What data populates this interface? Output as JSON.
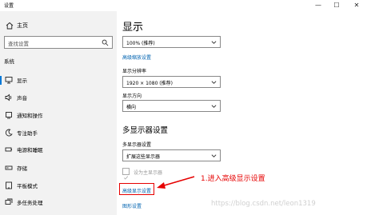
{
  "window": {
    "title": "设置",
    "controls": {
      "minimize": "—",
      "maximize": "☐",
      "close": "✕"
    }
  },
  "sidebar": {
    "home_label": "主页",
    "search_placeholder": "查找设置",
    "section_label": "系统",
    "items": [
      {
        "label": "显示",
        "icon": "monitor-icon",
        "selected": true
      },
      {
        "label": "声音",
        "icon": "speaker-icon"
      },
      {
        "label": "通知和操作",
        "icon": "notification-icon"
      },
      {
        "label": "专注助手",
        "icon": "moon-icon"
      },
      {
        "label": "电源和睡眠",
        "icon": "power-icon"
      },
      {
        "label": "存储",
        "icon": "storage-icon"
      },
      {
        "label": "平板模式",
        "icon": "tablet-icon"
      },
      {
        "label": "多任务处理",
        "icon": "multitask-icon"
      }
    ]
  },
  "main": {
    "title": "显示",
    "scale_value": "100% (推荐)",
    "advanced_scaling_link": "高级缩放设置",
    "resolution_label": "显示分辨率",
    "resolution_value": "1920 × 1080 (推荐)",
    "orientation_label": "显示方向",
    "orientation_value": "横向",
    "multi_display_heading": "多显示器设置",
    "multi_display_label": "多显示器设置",
    "multi_display_value": "扩展这些显示器",
    "main_display_checkbox": "设为主显示器",
    "advanced_display_link": "高级显示设置",
    "graphics_link": "图形设置"
  },
  "annotation": {
    "text": "1.进入高级显示设置",
    "color": "#e60000"
  },
  "watermark": "https://blog.csdn.net/leon1319",
  "colors": {
    "accent": "#0078d7",
    "link": "#0063b1",
    "sidebar_bg": "#f2f2f2"
  }
}
